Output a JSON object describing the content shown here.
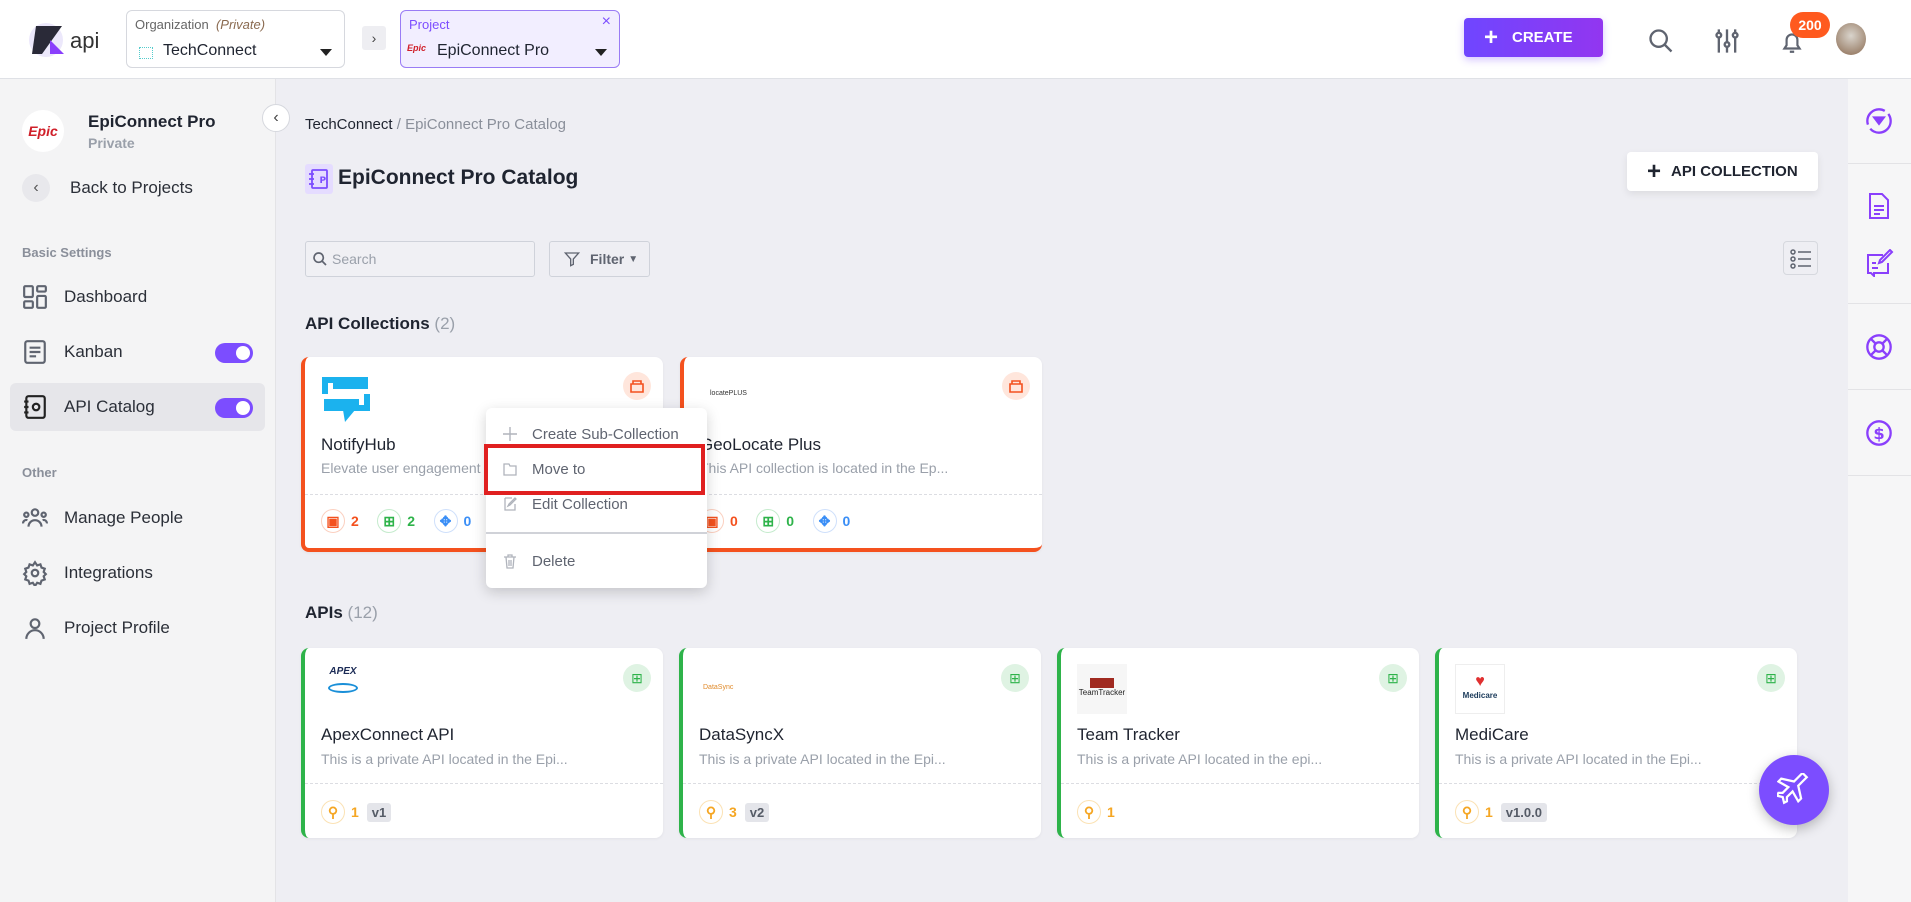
{
  "header": {
    "logo_text": "api",
    "organization": {
      "label": "Organization",
      "visibility": "(Private)",
      "value": "TechConnect"
    },
    "project": {
      "label": "Project",
      "value": "EpiConnect Pro",
      "logo_text": "Epic"
    },
    "create_label": "CREATE",
    "notification_count": "200"
  },
  "sidebar": {
    "project_name": "EpiConnect Pro",
    "project_visibility": "Private",
    "project_logo_text": "Epic",
    "back_label": "Back to Projects",
    "section_basic": "Basic Settings",
    "section_other": "Other",
    "items": [
      {
        "label": "Dashboard",
        "icon": "dashboard-icon"
      },
      {
        "label": "Kanban",
        "icon": "kanban-icon",
        "toggle": true
      },
      {
        "label": "API Catalog",
        "icon": "catalog-icon",
        "toggle": true,
        "active": true
      },
      {
        "label": "Manage People",
        "icon": "people-icon"
      },
      {
        "label": "Integrations",
        "icon": "gear-icon"
      },
      {
        "label": "Project Profile",
        "icon": "user-icon"
      }
    ]
  },
  "main": {
    "breadcrumb": {
      "root": "TechConnect",
      "sep": " / ",
      "current": "EpiConnect Pro Catalog"
    },
    "title": "EpiConnect Pro Catalog",
    "add_collection_label": "API COLLECTION",
    "search_placeholder": "Search",
    "filter_label": "Filter",
    "collections_heading": "API Collections",
    "collections_count": "(2)",
    "collections": [
      {
        "name": "NotifyHub",
        "desc": "Elevate user engagement",
        "counts": [
          "2",
          "2",
          "0"
        ]
      },
      {
        "name": "GeoLocate Plus",
        "desc": "This API collection is located in the Ep...",
        "counts": [
          "0",
          "0",
          "0"
        ],
        "logo_text": "locatePLUS"
      }
    ],
    "apis_heading": "APIs",
    "apis_count": "(12)",
    "apis": [
      {
        "name": "ApexConnect API",
        "desc": "This is a private API located in the Epi...",
        "count": "1",
        "version": "v1",
        "logo_text": "APEX"
      },
      {
        "name": "DataSyncX",
        "desc": "This is a private API located in the Epi...",
        "count": "3",
        "version": "v2",
        "logo_text": "DataSync"
      },
      {
        "name": "Team Tracker",
        "desc": "This is a private API located in the epi...",
        "count": "1",
        "logo_text": "TeamTracker"
      },
      {
        "name": "MediCare",
        "desc": "This is a private API located in the Epi...",
        "count": "1",
        "version": "v1.0.0",
        "logo_text": "Medicare"
      }
    ]
  },
  "context_menu": {
    "items": [
      "Create Sub-Collection",
      "Move to",
      "Edit Collection",
      "Delete"
    ],
    "highlighted": "Move to"
  },
  "colors": {
    "accent": "#7c4dff",
    "collection": "#f4511e",
    "api": "#2eb34a",
    "highlight_box": "#e02020",
    "badge": "#ff5a1f"
  }
}
